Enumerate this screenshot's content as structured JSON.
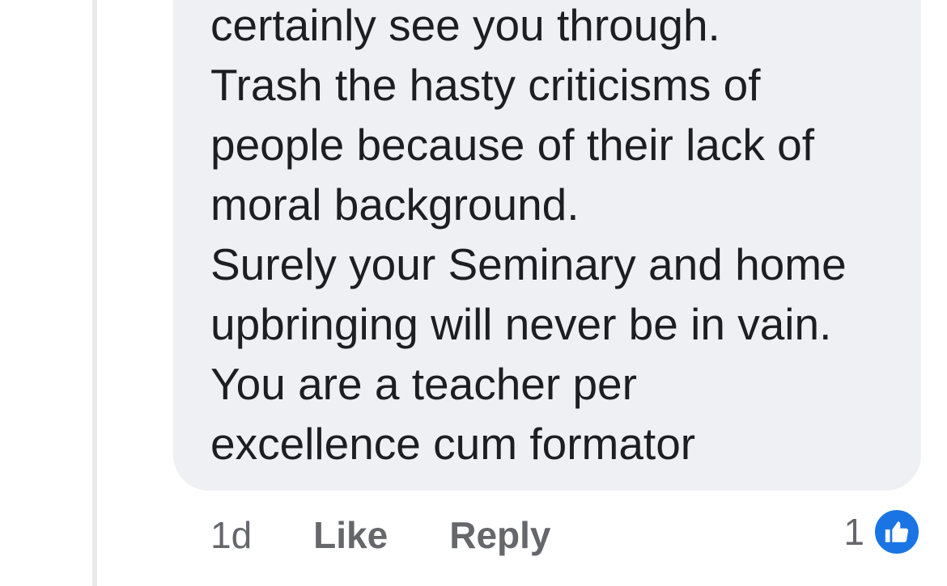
{
  "comment": {
    "lines": [
      "certainly see you through.",
      "Trash the hasty criticisms of",
      "people because of their lack of",
      "moral background.",
      "Surely your Seminary and home",
      "upbringing will never be in vain.",
      "You are a teacher per",
      "excellence cum formator"
    ]
  },
  "actions": {
    "time": "1d",
    "like_label": "Like",
    "reply_label": "Reply"
  },
  "reactions": {
    "count": "1",
    "icon": "thumbs-up-icon",
    "icon_color": "#1b74e4"
  },
  "colors": {
    "bubble": "#eff0f3",
    "text": "#1c1e21",
    "meta_text": "#65676b",
    "thread_line": "#e9eaee"
  }
}
